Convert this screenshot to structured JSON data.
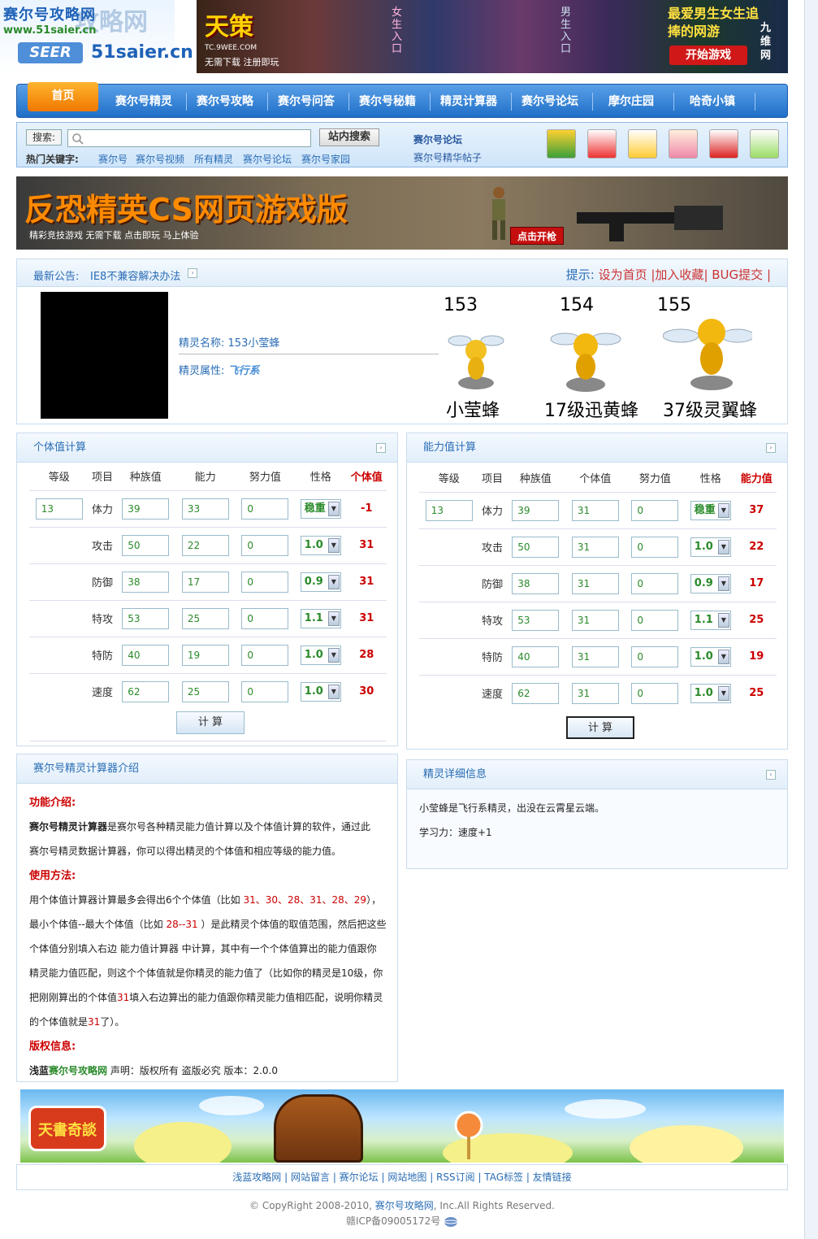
{
  "logo": {
    "line1": "赛尔号攻略网",
    "line1b": "攻略网",
    "url": "www.51saier.cn",
    "seer": "SEER",
    "site": "51saier.cn"
  },
  "top_ad": {
    "brand": "天策",
    "url": "TC.9WEE.COM",
    "sub": "无需下载 注册即玩",
    "girl": "女生入口",
    "boy": "男生入口",
    "slogan": "最爱男生女生追捧的网游",
    "play": "开始游戏",
    "nine": "九维网"
  },
  "nav": {
    "home": "首页",
    "items": [
      "赛尔号精灵",
      "赛尔号攻略",
      "赛尔号问答",
      "赛尔号秘籍",
      "精灵计算器",
      "赛尔号论坛",
      "摩尔庄园",
      "哈奇小镇"
    ]
  },
  "search": {
    "label": "搜索:",
    "button": "站内搜索",
    "hot_label": "热门关键字:",
    "keywords": [
      "赛尔号",
      "赛尔号视频",
      "所有精灵",
      "赛尔号论坛",
      "赛尔号家园"
    ],
    "forum_title": "赛尔号论坛",
    "forum_sub": "赛尔号精华帖子"
  },
  "cs_banner": {
    "title": "反恐精英CS网页游戏版",
    "tag": "精彩竞技游戏  无需下载  点击即玩  马上体验",
    "go": "点击开枪"
  },
  "notice": {
    "label": "最新公告:",
    "text": "IE8不兼容解决办法",
    "tip": "提示:",
    "links": [
      "设为首页",
      "加入收藏",
      "BUG提交"
    ]
  },
  "sprite": {
    "name_label": "精灵名称:",
    "name": "153小莹蜂",
    "attr_label": "精灵属性:",
    "attr": "飞行系",
    "evo": [
      {
        "num": "153",
        "name": "小莹蜂"
      },
      {
        "num": "154",
        "name": "17级迅黄蜂"
      },
      {
        "num": "155",
        "name": "37级灵翼蜂"
      }
    ]
  },
  "iv_calc": {
    "title": "个体值计算",
    "headers": [
      "等级",
      "项目",
      "种族值",
      "能力",
      "努力值",
      "性格",
      "个体值"
    ],
    "level": "13",
    "rows": [
      {
        "item": "体力",
        "base": "39",
        "stat": "33",
        "ev": "0",
        "nature": "稳重",
        "result": "-1"
      },
      {
        "item": "攻击",
        "base": "50",
        "stat": "22",
        "ev": "0",
        "nature": "1.0",
        "result": "31"
      },
      {
        "item": "防御",
        "base": "38",
        "stat": "17",
        "ev": "0",
        "nature": "0.9",
        "result": "31"
      },
      {
        "item": "特攻",
        "base": "53",
        "stat": "25",
        "ev": "0",
        "nature": "1.1",
        "result": "31"
      },
      {
        "item": "特防",
        "base": "40",
        "stat": "19",
        "ev": "0",
        "nature": "1.0",
        "result": "28"
      },
      {
        "item": "速度",
        "base": "62",
        "stat": "25",
        "ev": "0",
        "nature": "1.0",
        "result": "30"
      }
    ],
    "button": "计 算"
  },
  "stat_calc": {
    "title": "能力值计算",
    "headers": [
      "等级",
      "项目",
      "种族值",
      "个体值",
      "努力值",
      "性格",
      "能力值"
    ],
    "level": "13",
    "rows": [
      {
        "item": "体力",
        "base": "39",
        "iv": "31",
        "ev": "0",
        "nature": "稳重",
        "result": "37"
      },
      {
        "item": "攻击",
        "base": "50",
        "iv": "31",
        "ev": "0",
        "nature": "1.0",
        "result": "22"
      },
      {
        "item": "防御",
        "base": "38",
        "iv": "31",
        "ev": "0",
        "nature": "0.9",
        "result": "17"
      },
      {
        "item": "特攻",
        "base": "53",
        "iv": "31",
        "ev": "0",
        "nature": "1.1",
        "result": "25"
      },
      {
        "item": "特防",
        "base": "40",
        "iv": "31",
        "ev": "0",
        "nature": "1.0",
        "result": "19"
      },
      {
        "item": "速度",
        "base": "62",
        "iv": "31",
        "ev": "0",
        "nature": "1.0",
        "result": "25"
      }
    ],
    "button": "计 算"
  },
  "intro": {
    "title": "赛尔号精灵计算器介绍",
    "h1": "功能介绍:",
    "p1a": "赛尔号精灵计算器",
    "p1b": "是赛尔号各种精灵能力值计算以及个体值计算的软件，通过此",
    "p1c": "赛尔号精灵数据计算器，你可以得出精灵的个体值和相应等级的能力值。",
    "h2": "使用方法:",
    "l1a": "用个体值计算器计算最多会得出6个个体值（比如 ",
    "l1r": "31、30、28、31、28、29",
    "l1b": "），",
    "l2a": "最小个体值--最大个体值（比如 ",
    "l2r": "28--31",
    "l2b": " ）是此精灵个体值的取值范围，然后把这些",
    "l3": "个体值分别填入右边 能力值计算器 中计算，其中有一个个体值算出的能力值跟你",
    "l4": "精灵能力值匹配，则这个个体值就是你精灵的能力值了（比如你的精灵是10级，你",
    "l5a": "把刚刚算出的个体值",
    "l5r": "31",
    "l5b": "填入右边算出的能力值跟你精灵能力值相匹配，说明你精灵",
    "l6a": "的个体值就是",
    "l6r": "31",
    "l6b": "了）。",
    "h3": "版权信息:",
    "c1": "浅蓝",
    "c2": "赛尔号攻略网",
    "c3": " 声明：版权所有 盗版必究 版本：2.0.0"
  },
  "detail": {
    "title": "精灵详细信息",
    "line1": "小莹蜂是飞行系精灵，出没在云霄星云端。",
    "line2": "学习力：速度+1"
  },
  "bottom_banner": {
    "logo": "天書奇談"
  },
  "footer": {
    "links": [
      "浅蓝攻略网",
      "网站留言",
      "赛尔论坛",
      "网站地图",
      "RSS订阅",
      "TAG标签",
      "友情链接"
    ],
    "copy_a": "© CopyRight 2008-2010, ",
    "copy_b": "赛尔号攻略网",
    "copy_c": ", Inc.All Rights Reserved.",
    "icp": "赣ICP备09005172号"
  }
}
